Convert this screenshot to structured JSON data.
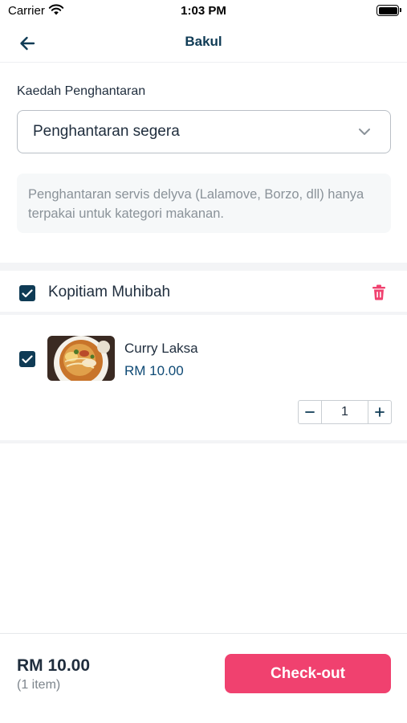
{
  "status_bar": {
    "carrier": "Carrier",
    "time": "1:03 PM"
  },
  "header": {
    "title": "Bakul",
    "back_icon": "arrow-left-icon"
  },
  "delivery": {
    "label": "Kaedah Penghantaran",
    "selected": "Penghantaran segera",
    "info": "Penghantaran servis delyva (Lalamove, Borzo, dll) hanya terpakai untuk kategori makanan."
  },
  "store": {
    "name": "Kopitiam Muhibah",
    "checked": true,
    "delete_icon": "trash-icon"
  },
  "items": [
    {
      "name": "Curry Laksa",
      "price": "RM 10.00",
      "quantity": "1",
      "checked": true
    }
  ],
  "footer": {
    "total": "RM 10.00",
    "count": "(1 item)",
    "checkout_label": "Check-out"
  },
  "colors": {
    "primary": "#0f3b55",
    "accent": "#f0416f",
    "price": "#0f4a75"
  }
}
